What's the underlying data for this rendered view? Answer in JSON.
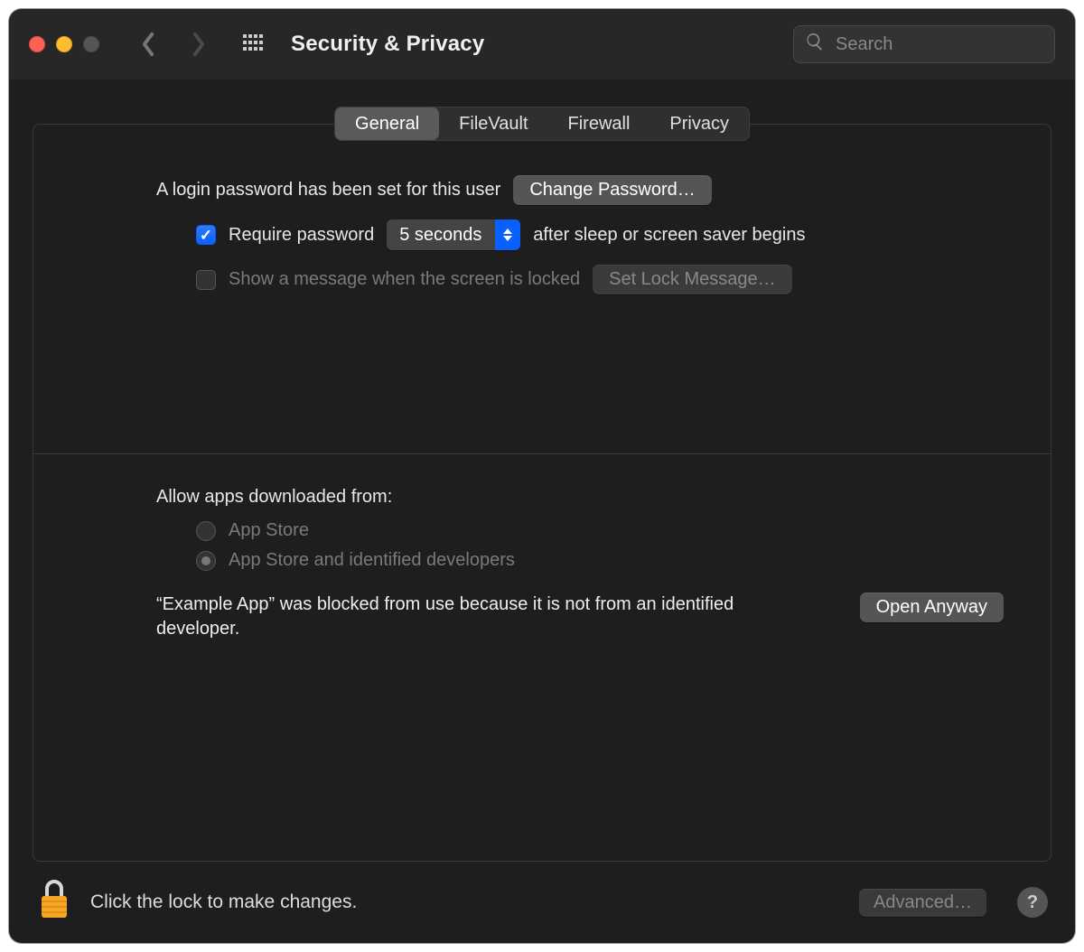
{
  "window": {
    "title": "Security & Privacy"
  },
  "search": {
    "placeholder": "Search"
  },
  "tabs": {
    "general": "General",
    "filevault": "FileVault",
    "firewall": "Firewall",
    "privacy": "Privacy"
  },
  "login": {
    "status_text": "A login password has been set for this user",
    "change_password_button": "Change Password…",
    "require_password_label": "Require password",
    "require_password_delay": "5 seconds",
    "after_sleep_text": "after sleep or screen saver begins",
    "show_lock_message_label": "Show a message when the screen is locked",
    "set_lock_message_button": "Set Lock Message…"
  },
  "allow_apps": {
    "heading": "Allow apps downloaded from:",
    "option_app_store": "App Store",
    "option_app_store_identified": "App Store and identified developers",
    "blocked_message": "“Example App” was blocked from use because it is not from an identified developer.",
    "open_anyway_button": "Open Anyway"
  },
  "footer": {
    "lock_hint": "Click the lock to make changes.",
    "advanced_button": "Advanced…",
    "help_label": "?"
  }
}
